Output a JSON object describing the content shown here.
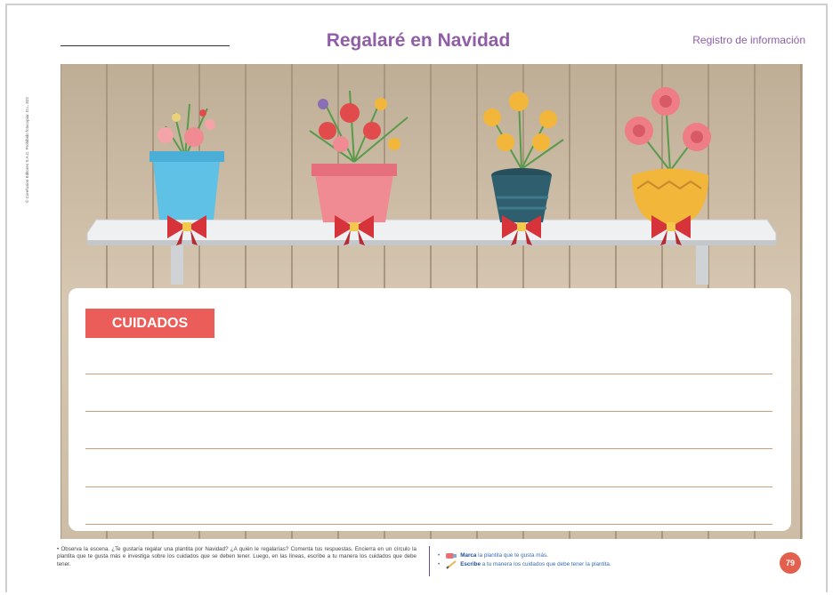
{
  "header": {
    "title": "Regalaré en Navidad",
    "section": "Registro de información"
  },
  "copyright": "© Corefusion Editores S.A.C. Prohibido fotocopiar. D.L. 822",
  "scene": {
    "colors": {
      "wood": "#c9b8a0",
      "shelf": "#eef0f1",
      "bow": "#d6343a",
      "pot1": "#5fc1e6",
      "pot2": "#f08a93",
      "pot3": "#2f5f6e",
      "pot4": "#f2b73a"
    },
    "plants": [
      "potted-plant-blue",
      "potted-plant-pink",
      "potted-plant-teal",
      "potted-plant-yellow"
    ]
  },
  "care": {
    "label": "CUIDADOS",
    "line_count": 5
  },
  "footer": {
    "instructions": "• Observa la escena. ¿Te gustaría regalar una plantita por Navidad? ¿A quién le regalarías? Comenta tus respuestas. Encierra en un círculo la plantita que te gusta más e investiga sobre los cuidados que se deben tener. Luego, en las líneas, escribe a tu manera los cuidados que debe tener.",
    "task1_bold": "Marca",
    "task1_text": "la plantita que te gusta más.",
    "task2_bold": "Escribe",
    "task2_text": "a tu manera los cuidados que debe tener la plantita.",
    "page_number": "79"
  }
}
